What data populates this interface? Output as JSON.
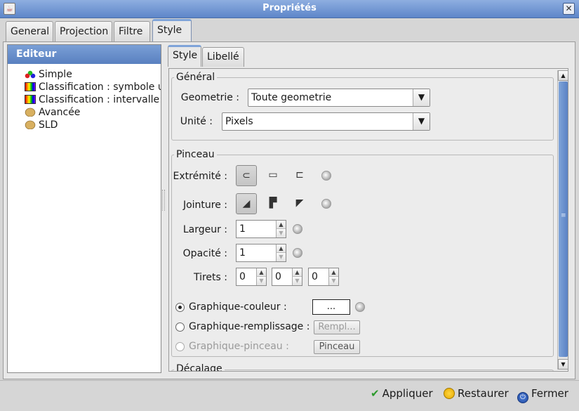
{
  "window": {
    "title": "Propriétés"
  },
  "main_tabs": [
    "General",
    "Projection",
    "Filtre",
    "Style"
  ],
  "editor": {
    "header": "Editeur",
    "items": [
      {
        "label": "Simple",
        "icon": "simple-style-icon"
      },
      {
        "label": "Classification : symbole u",
        "icon": "gradient-icon"
      },
      {
        "label": "Classification : intervalle",
        "icon": "gradient-icon"
      },
      {
        "label": "Avancée",
        "icon": "palette-icon"
      },
      {
        "label": "SLD",
        "icon": "palette-icon"
      }
    ]
  },
  "inner_tabs": [
    "Style",
    "Libellé"
  ],
  "general": {
    "legend": "Général",
    "geometry_label": "Geometrie :",
    "geometry_value": "Toute geometrie",
    "unit_label": "Unité :",
    "unit_value": "Pixels"
  },
  "pinceau": {
    "legend": "Pinceau",
    "extremite_label": "Extrémité :",
    "jointure_label": "Jointure :",
    "largeur_label": "Largeur :",
    "largeur_value": "1",
    "opacite_label": "Opacité :",
    "opacite_value": "1",
    "tirets_label": "Tirets :",
    "tirets_values": [
      "0",
      "0",
      "0"
    ],
    "graphique_couleur_label": "Graphique-couleur :",
    "graphique_couleur_button": "...",
    "graphique_remplissage_label": "Graphique-remplissage :",
    "remplissage_button": "Rempl...",
    "graphique_pinceau_label": "Graphique-pinceau :",
    "pinceau_button": "Pinceau",
    "selected_graphic": "Graphique-couleur"
  },
  "decalage": {
    "legend": "Décalage"
  },
  "footer": {
    "apply": "Appliquer",
    "restore": "Restaurer",
    "close": "Fermer"
  },
  "colors": {
    "accent": "#7fa4d9",
    "title_bar": "#6f93cf"
  }
}
